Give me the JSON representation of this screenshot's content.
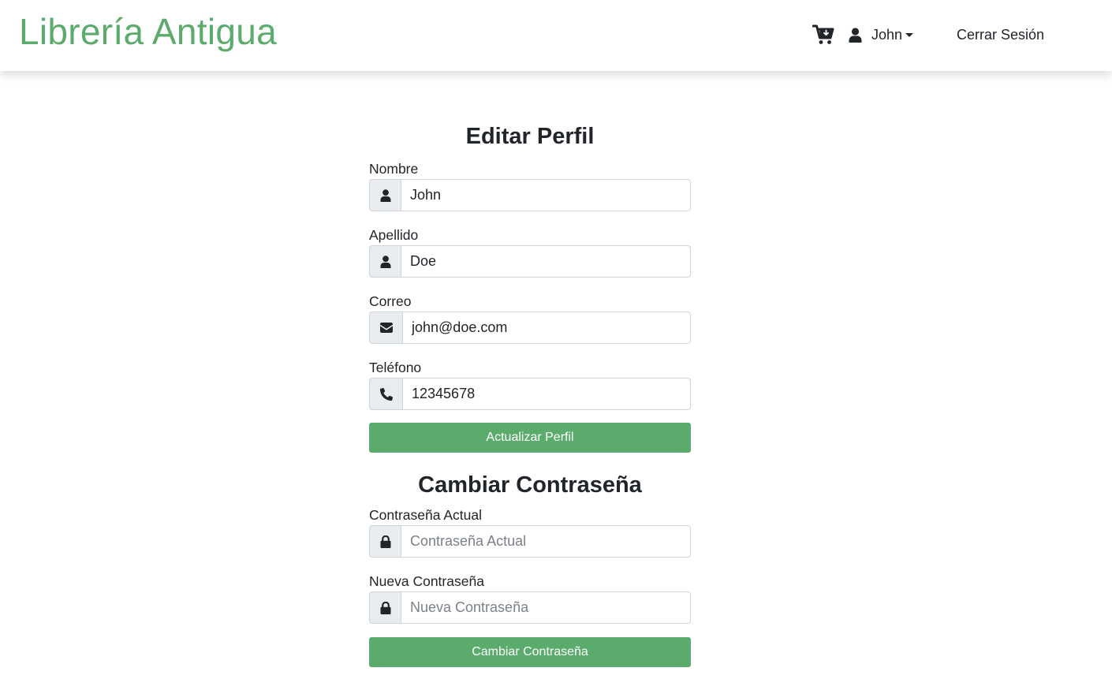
{
  "navbar": {
    "brand": "Librería Antigua",
    "cart_icon": "cart-plus-icon",
    "user_icon": "user-icon",
    "username": "John",
    "logout": "Cerrar Sesión"
  },
  "profile": {
    "title": "Editar Perfil",
    "fields": [
      {
        "label": "Nombre",
        "value": "John",
        "icon": "user-icon"
      },
      {
        "label": "Apellido",
        "value": "Doe",
        "icon": "user-icon"
      },
      {
        "label": "Correo",
        "value": "john@doe.com",
        "icon": "envelope-icon"
      },
      {
        "label": "Teléfono",
        "value": "12345678",
        "icon": "phone-icon"
      }
    ],
    "submit": "Actualizar Perfil"
  },
  "password": {
    "title": "Cambiar Contraseña",
    "fields": [
      {
        "label": "Contraseña Actual",
        "placeholder": "Contraseña Actual",
        "icon": "lock-icon"
      },
      {
        "label": "Nueva Contraseña",
        "placeholder": "Nueva Contraseña",
        "icon": "lock-icon"
      }
    ],
    "submit": "Cambiar Contraseña"
  },
  "colors": {
    "brand": "#5aab6c",
    "button": "#5aab6c",
    "addon_bg": "#e9ecef",
    "border": "#ced4da",
    "text": "#212529"
  }
}
